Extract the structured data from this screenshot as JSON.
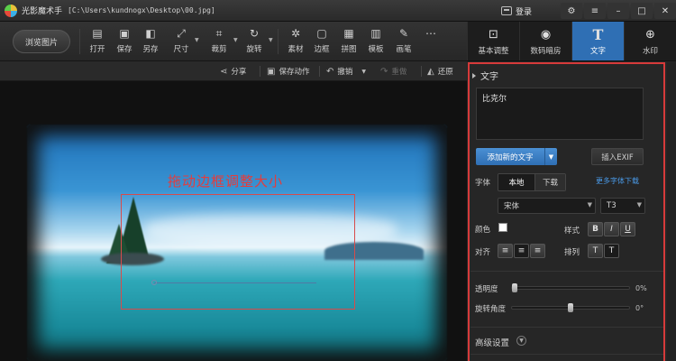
{
  "window": {
    "app_name": "光影魔术手",
    "path": "[C:\\Users\\kundnogx\\Desktop\\00.jpg]",
    "login_label": "登录",
    "controls": [
      "⚙",
      "≡",
      "–",
      "□",
      "✕"
    ]
  },
  "toolbar": {
    "browse_label": "浏览图片",
    "tools": [
      {
        "icon": "open-icon",
        "glyph": "▤",
        "label": "打开"
      },
      {
        "icon": "save-icon",
        "glyph": "▣",
        "label": "保存"
      },
      {
        "icon": "save-as-icon",
        "glyph": "◧",
        "label": "另存"
      },
      {
        "icon": "resize-icon",
        "glyph": "⤢",
        "label": "尺寸"
      },
      {
        "icon": "crop-icon",
        "glyph": "⌗",
        "label": "裁剪"
      },
      {
        "icon": "rotate-icon",
        "glyph": "↻",
        "label": "旋转"
      },
      {
        "icon": "material-icon",
        "glyph": "✲",
        "label": "素材"
      },
      {
        "icon": "border-icon",
        "glyph": "▢",
        "label": "边框"
      },
      {
        "icon": "collage-icon",
        "glyph": "▦",
        "label": "拼图"
      },
      {
        "icon": "template-icon",
        "glyph": "▥",
        "label": "模板"
      },
      {
        "icon": "brush-icon",
        "glyph": "✎",
        "label": "画笔"
      }
    ],
    "more_glyph": "⋯"
  },
  "tabs": [
    {
      "icon": "basic-adjust-icon",
      "glyph": "⊡",
      "label": "基本调整",
      "active": false
    },
    {
      "icon": "darkroom-icon",
      "glyph": "◉",
      "label": "数码暗房",
      "active": false
    },
    {
      "icon": "text-icon",
      "glyph": "T",
      "label": "文字",
      "active": true
    },
    {
      "icon": "watermark-icon",
      "glyph": "⊕",
      "label": "水印",
      "active": false
    }
  ],
  "actions": {
    "share": "分享",
    "save_action": "保存动作",
    "undo": "撤销",
    "redo": "重做",
    "restore": "还原"
  },
  "canvas": {
    "caption": "拖动边框调整大小"
  },
  "text_panel": {
    "section_title": "文字",
    "text_value": "比克尔",
    "add_button": "添加新的文字",
    "exif_button": "插入EXIF",
    "font_label": "字体",
    "font_source_options": [
      "本地",
      "下载"
    ],
    "font_source_selected": "本地",
    "more_fonts_link": "更多字体下载",
    "font_name": "宋体",
    "font_size": "T3",
    "color_label": "颜色",
    "color_value": "#ffffff",
    "style_label": "样式",
    "style_buttons": [
      "B",
      "I",
      "U"
    ],
    "align_label": "对齐",
    "align_buttons": [
      "≡",
      "≡",
      "≡"
    ],
    "arrange_label": "排列",
    "arrange_buttons": [
      "T",
      "T"
    ],
    "opacity_label": "透明度",
    "opacity_value": "0%",
    "opacity_fraction": 0,
    "rotation_label": "旋转角度",
    "rotation_value": "0°",
    "rotation_fraction": 0.5,
    "advanced_label": "高级设置"
  },
  "colors": {
    "accent_blue": "#2f6fb4",
    "highlight_red": "#d63a3a",
    "caption_red": "#e43c3c",
    "link_blue": "#4a9ae8"
  }
}
